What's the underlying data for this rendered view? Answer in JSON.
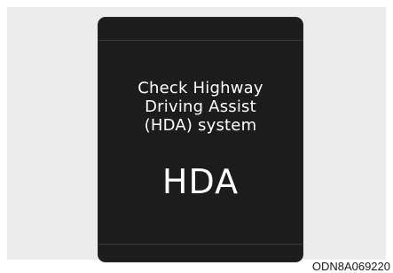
{
  "display": {
    "message_lines": [
      "Check Highway",
      "Driving Assist",
      "(HDA) system"
    ],
    "indicator": "HDA"
  },
  "figure": {
    "code": "ODN8A069220"
  },
  "colors": {
    "screen_background": "#1c1c1c",
    "text": "#ffffff",
    "panel_background": "#ececec"
  }
}
